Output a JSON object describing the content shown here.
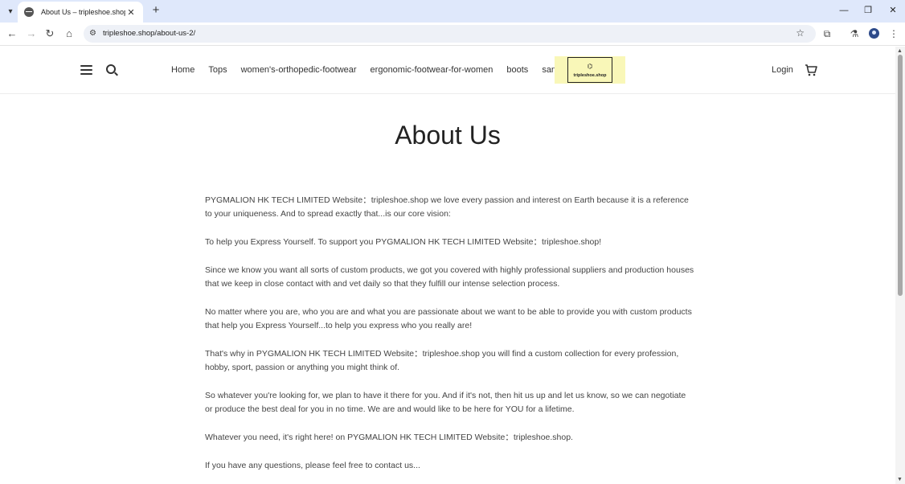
{
  "browser": {
    "tab_title": "About Us – tripleshoe.shop",
    "url": "tripleshoe.shop/about-us-2/"
  },
  "icons": {
    "tab_dropdown": "chevron-down-icon",
    "favicon": "globe-icon",
    "tab_close": "close-icon",
    "new_tab": "plus-icon",
    "minimize": "minimize-icon",
    "restore": "restore-icon",
    "window_close": "close-icon",
    "back": "back-arrow-icon",
    "forward": "forward-arrow-icon",
    "reload": "reload-icon",
    "home": "home-icon",
    "site_info": "tune-icon",
    "bookmark": "star-icon",
    "extensions": "puzzle-icon",
    "labs": "flask-icon",
    "profile": "avatar-icon",
    "menu": "kebab-menu-icon",
    "hamburger": "hamburger-menu-icon",
    "search": "search-icon",
    "cart": "cart-icon"
  },
  "site": {
    "nav": [
      "Home",
      "Tops",
      "women's-orthopedic-footwear",
      "ergonomic-footwear-for-women",
      "boots",
      "sandals"
    ],
    "logo_text": "tripleshoe.shop",
    "login": "Login"
  },
  "page": {
    "title": "About Us",
    "paragraphs": [
      "PYGMALION HK TECH LIMITED Website：tripleshoe.shop we love every passion and interest on Earth because it is a reference to your uniqueness. And to spread exactly that...is our core vision:",
      "To help you Express Yourself. To support you PYGMALION HK TECH LIMITED Website：tripleshoe.shop!",
      "Since we know you want all sorts of custom products, we got you covered with highly professional suppliers and production houses that we keep in close contact with and vet daily so that they fulfill our intense selection process.",
      "No matter where you are, who you are and what you are passionate about we want to be able to provide you with custom products that help you Express Yourself...to help you express who you really are!",
      "That's why in PYGMALION HK TECH LIMITED Website：tripleshoe.shop you will find a custom collection for every profession, hobby, sport, passion or anything you might think of.",
      "So whatever you're looking for, we plan to have it there for you. And if it's not, then hit us up and let us know, so we can negotiate or produce the best deal for you in no time. We are and would like to be here for YOU for a lifetime.",
      "Whatever you need, it's right here! on PYGMALION HK TECH LIMITED Website：tripleshoe.shop.",
      "If you have any questions, please feel free to contact us..."
    ]
  },
  "colors": {
    "tabbar_bg": "#dfe8fb",
    "logo_bg": "#f9f7b8",
    "text": "#444444"
  }
}
